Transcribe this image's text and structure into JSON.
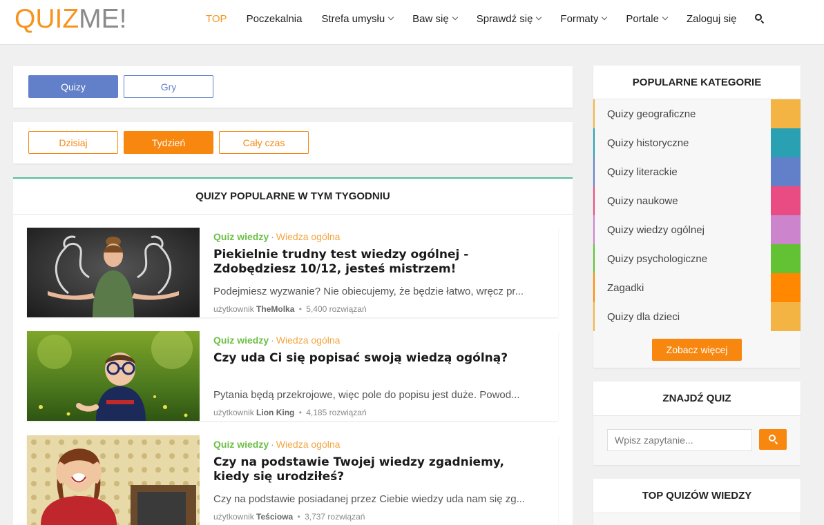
{
  "header": {
    "logo_part1": "QUIZ",
    "logo_part2": "ME!",
    "nav": [
      {
        "label": "TOP",
        "dropdown": false,
        "active": true
      },
      {
        "label": "Poczekalnia",
        "dropdown": false
      },
      {
        "label": "Strefa umysłu",
        "dropdown": true
      },
      {
        "label": "Baw się",
        "dropdown": true
      },
      {
        "label": "Sprawdź się",
        "dropdown": true
      },
      {
        "label": "Formaty",
        "dropdown": true
      },
      {
        "label": "Portale",
        "dropdown": true
      },
      {
        "label": "Zaloguj się",
        "dropdown": false
      }
    ]
  },
  "type_tabs": {
    "quizy": "Quizy",
    "gry": "Gry"
  },
  "period_tabs": {
    "dzisiaj": "Dzisiaj",
    "tydzien": "Tydzień",
    "caly_czas": "Cały czas"
  },
  "section_title": "QUIZY POPULARNE W TYM TYGODNIU",
  "quizzes": [
    {
      "category": "Quiz wiedzy",
      "subcategory": "Wiedza ogólna",
      "title": "Piekielnie trudny test wiedzy ogólnej - Zdobędziesz 10/12, jesteś mistrzem!",
      "description": "Podejmiesz wyzwanie? Nie obiecujemy, że będzie łatwo, wręcz pr...",
      "user_prefix": "użytkownik",
      "user": "TheMolka",
      "solves": "5,400 rozwiązań"
    },
    {
      "category": "Quiz wiedzy",
      "subcategory": "Wiedza ogólna",
      "title": "Czy uda Ci się popisać swoją wiedzą ogólną?",
      "description": "Pytania będą przekrojowe, więc pole do popisu jest duże. Powod...",
      "user_prefix": "użytkownik",
      "user": "Lion King",
      "solves": "4,185 rozwiązań"
    },
    {
      "category": "Quiz wiedzy",
      "subcategory": "Wiedza ogólna",
      "title": "Czy na podstawie Twojej wiedzy zgadniemy, kiedy się urodziłeś?",
      "description": "Czy na podstawie posiadanej przez Ciebie wiedzy uda nam się zg...",
      "user_prefix": "użytkownik",
      "user": "Teściowa",
      "solves": "3,737 rozwiązań"
    }
  ],
  "sidebar": {
    "popular_title": "POPULARNE KATEGORIE",
    "categories": [
      {
        "label": "Quizy geograficzne",
        "color": "#f4b443"
      },
      {
        "label": "Quizy historyczne",
        "color": "#2aa0b3"
      },
      {
        "label": "Quizy literackie",
        "color": "#6280c9"
      },
      {
        "label": "Quizy naukowe",
        "color": "#e84c83"
      },
      {
        "label": "Quizy wiedzy ogólnej",
        "color": "#cc85cc"
      },
      {
        "label": "Quizy psychologiczne",
        "color": "#62c234"
      },
      {
        "label": "Zagadki",
        "color": "#ff8800"
      },
      {
        "label": "Quizy dla dzieci",
        "color": "#f4b443"
      }
    ],
    "more_button": "Zobacz więcej",
    "find_title": "ZNAJDŹ QUIZ",
    "search_placeholder": "Wpisz zapytanie...",
    "top_title": "TOP QUIZÓW WIEDZY"
  },
  "colors": {
    "accent_orange": "#f7870f",
    "accent_blue": "#6280c9",
    "category_green": "#6cbf45",
    "section_border": "#4fbf9c"
  }
}
